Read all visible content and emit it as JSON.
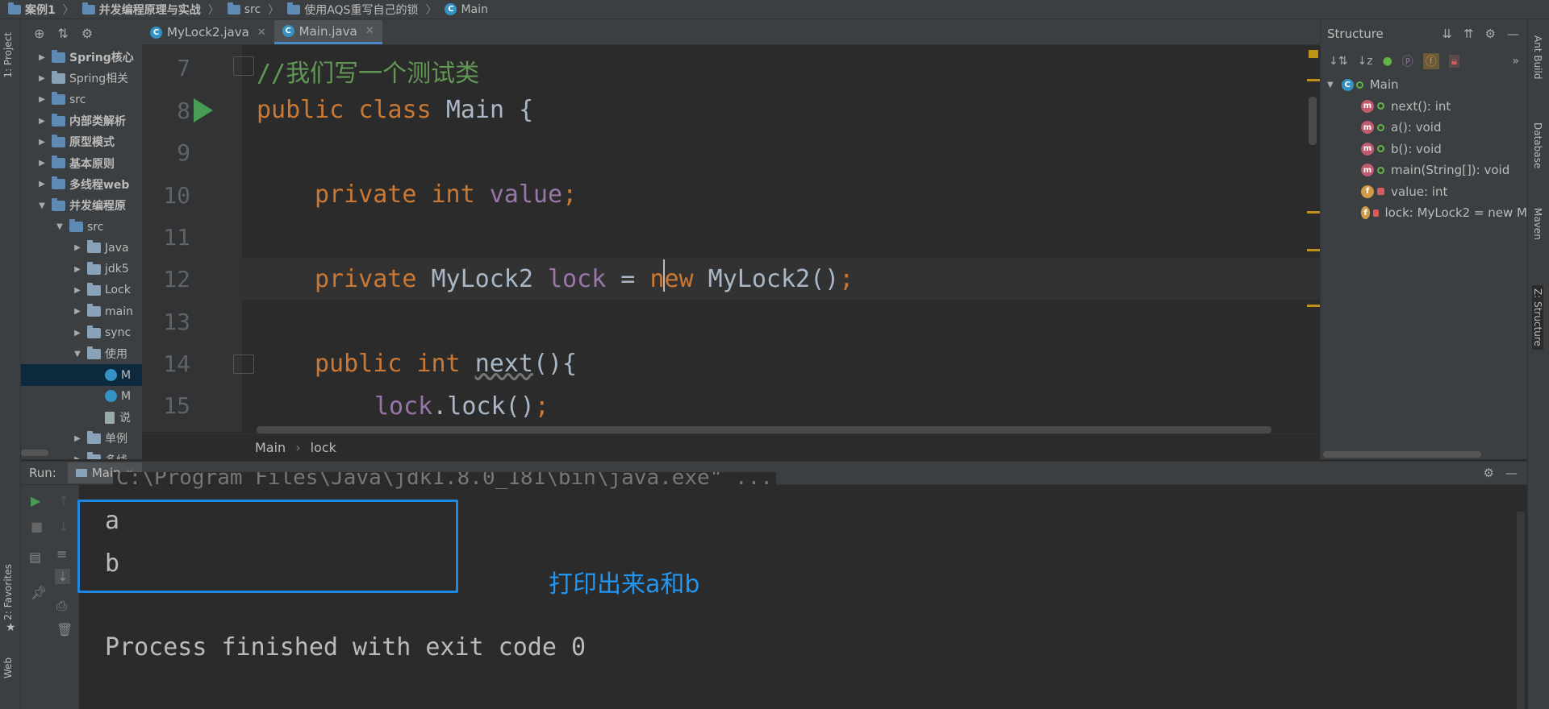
{
  "breadcrumb": [
    "案例1",
    "并发编程原理与实战",
    "src",
    "使用AQS重写自己的锁",
    "Main"
  ],
  "left_strip": {
    "project_tab": "1: Project",
    "favorites_tab": "2: Favorites",
    "web_tab": "Web"
  },
  "right_strip": {
    "ant_build": "Ant Build",
    "database": "Database",
    "maven": "Maven",
    "structure": "Z: Structure"
  },
  "project_tree": [
    {
      "label": "Spring核心",
      "bold": true,
      "indent": 0,
      "arrow": "▶"
    },
    {
      "label": "Spring相关",
      "bold": false,
      "indent": 0,
      "arrow": "▶"
    },
    {
      "label": "src",
      "bold": false,
      "indent": 0,
      "arrow": "▶"
    },
    {
      "label": "内部类解析",
      "bold": true,
      "indent": 0,
      "arrow": "▶"
    },
    {
      "label": "原型模式",
      "bold": true,
      "indent": 0,
      "arrow": "▶"
    },
    {
      "label": "基本原则",
      "bold": true,
      "indent": 0,
      "arrow": "▶"
    },
    {
      "label": "多线程web",
      "bold": true,
      "indent": 0,
      "arrow": "▶"
    },
    {
      "label": "并发编程原",
      "bold": true,
      "indent": 0,
      "arrow": "▼"
    },
    {
      "label": "src",
      "bold": false,
      "indent": 1,
      "arrow": "▼"
    },
    {
      "label": "Java",
      "bold": false,
      "indent": 2,
      "arrow": "▶"
    },
    {
      "label": "jdk5",
      "bold": false,
      "indent": 2,
      "arrow": "▶"
    },
    {
      "label": "Lock",
      "bold": false,
      "indent": 2,
      "arrow": "▶"
    },
    {
      "label": "main",
      "bold": false,
      "indent": 2,
      "arrow": "▶"
    },
    {
      "label": "sync",
      "bold": false,
      "indent": 2,
      "arrow": "▶"
    },
    {
      "label": "使用",
      "bold": false,
      "indent": 2,
      "arrow": "▼"
    },
    {
      "label": "M",
      "bold": false,
      "indent": 3,
      "arrow": ""
    },
    {
      "label": "M",
      "bold": false,
      "indent": 3,
      "arrow": ""
    },
    {
      "label": "说",
      "bold": false,
      "indent": 3,
      "arrow": ""
    },
    {
      "label": "单例",
      "bold": false,
      "indent": 2,
      "arrow": "▶"
    },
    {
      "label": "多线",
      "bold": false,
      "indent": 2,
      "arrow": "▶"
    }
  ],
  "tabs": [
    {
      "label": "MyLock2.java",
      "active": false
    },
    {
      "label": "Main.java",
      "active": true
    }
  ],
  "editor": {
    "line_numbers": [
      "7",
      "8",
      "9",
      "10",
      "11",
      "12",
      "13",
      "14",
      "15"
    ],
    "comment": "//我们写一个测试类",
    "class_line": {
      "kw1": "public",
      "kw2": "class",
      "name": "Main {"
    },
    "field1": {
      "kw1": "private",
      "kw2": "int",
      "name": "value",
      "end": ";"
    },
    "field2": {
      "kw1": "private",
      "type": "MyLock2",
      "name": "lock",
      "eq": " = ",
      "kw_new": "new",
      "ctor": " MyLock2()",
      "end": ";"
    },
    "method": {
      "kw1": "public",
      "kw2": "int",
      "name": "next",
      "rest": "(){"
    },
    "call": {
      "obj": "lock",
      "rest": ".lock()",
      "end": ";"
    },
    "crumbs": [
      "Main",
      "lock"
    ]
  },
  "structure": {
    "title": "Structure",
    "root": "Main",
    "items": [
      {
        "kind": "m",
        "label": "next(): int",
        "access": "public"
      },
      {
        "kind": "m",
        "label": "a(): void",
        "access": "public"
      },
      {
        "kind": "m",
        "label": "b(): void",
        "access": "public"
      },
      {
        "kind": "m",
        "label": "main(String[]): void",
        "access": "public"
      },
      {
        "kind": "f",
        "label": "value: int",
        "access": "private"
      },
      {
        "kind": "f",
        "label": "lock: MyLock2 = new M",
        "access": "private"
      }
    ]
  },
  "run": {
    "label": "Run:",
    "config": "Main",
    "cmd_line": "C:\\Program Files\\Java\\jdk1.8.0_181\\bin\\java.exe\" ...",
    "output": [
      "a",
      "b"
    ],
    "finish": "Process finished with exit code 0",
    "annotation": "打印出来a和b"
  },
  "colors": {
    "accent": "#4a88c7",
    "highlight_box": "#1e88e5",
    "annotation": "#2196f3",
    "keyword": "#cc7832",
    "comment": "#629755",
    "field": "#9876aa"
  }
}
